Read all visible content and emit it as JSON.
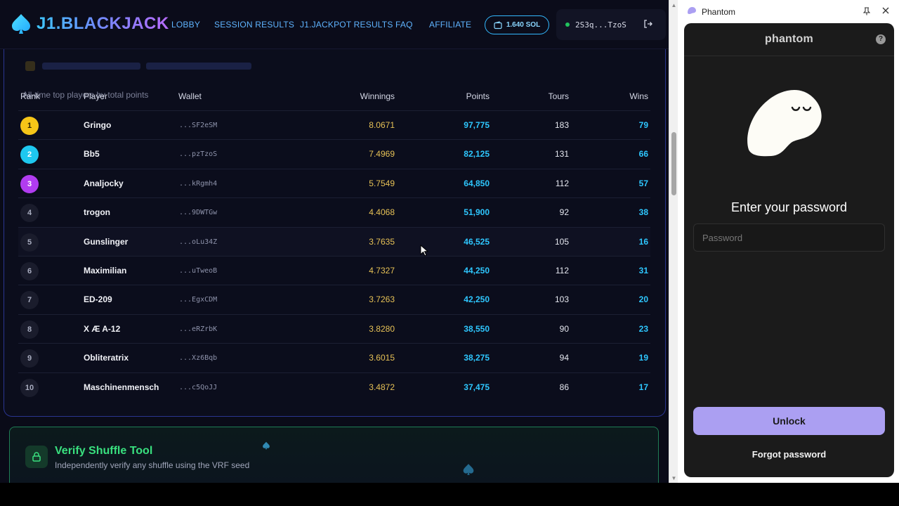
{
  "app": {
    "logo_text": "J1.BLACKJACK",
    "nav": [
      "LOBBY",
      "SESSION RESULTS",
      "J1.JACKPOT RESULTS",
      "FAQ",
      "AFFILIATE"
    ],
    "balance": "1.640 SOL",
    "wallet": "2S3q...TzoS",
    "colors": {
      "accent": "#2ec7ff",
      "gold": "#e6c156",
      "green": "#39e07f"
    }
  },
  "leaderboard": {
    "subtitle": "All-time top players by total points",
    "headers": {
      "rank": "Rank",
      "player": "Player",
      "wallet": "Wallet",
      "winnings": "Winnings",
      "points": "Points",
      "tours": "Tours",
      "wins": "Wins"
    },
    "rows": [
      {
        "rank": "1",
        "player": "Gringo",
        "wallet": "...SF2eSM",
        "winnings": "8.0671",
        "points": "97,775",
        "tours": "183",
        "wins": "79",
        "badge": "#f5c518",
        "badge_text": "#2a2000"
      },
      {
        "rank": "2",
        "player": "Bb5",
        "wallet": "...pzTzoS",
        "winnings": "7.4969",
        "points": "82,125",
        "tours": "131",
        "wins": "66",
        "badge": "#1ec8f0",
        "badge_text": "#ffffff"
      },
      {
        "rank": "3",
        "player": "Analjocky",
        "wallet": "...kRgmh4",
        "winnings": "5.7549",
        "points": "64,850",
        "tours": "112",
        "wins": "57",
        "badge": "#b13cf0",
        "badge_text": "#ffffff"
      },
      {
        "rank": "4",
        "player": "trogon",
        "wallet": "...9DWTGw",
        "winnings": "4.4068",
        "points": "51,900",
        "tours": "92",
        "wins": "38",
        "badge": "#1a1c2c",
        "badge_text": "#a8acbf"
      },
      {
        "rank": "5",
        "player": "Gunslinger",
        "wallet": "...oLu34Z",
        "winnings": "3.7635",
        "points": "46,525",
        "tours": "105",
        "wins": "16",
        "badge": "#1a1c2c",
        "badge_text": "#a8acbf"
      },
      {
        "rank": "6",
        "player": "Maximilian",
        "wallet": "...uTweoB",
        "winnings": "4.7327",
        "points": "44,250",
        "tours": "112",
        "wins": "31",
        "badge": "#1a1c2c",
        "badge_text": "#a8acbf"
      },
      {
        "rank": "7",
        "player": "ED-209",
        "wallet": "...EgxCDM",
        "winnings": "3.7263",
        "points": "42,250",
        "tours": "103",
        "wins": "20",
        "badge": "#1a1c2c",
        "badge_text": "#a8acbf"
      },
      {
        "rank": "8",
        "player": "X Æ A-12",
        "wallet": "...eRZrbK",
        "winnings": "3.8280",
        "points": "38,550",
        "tours": "90",
        "wins": "23",
        "badge": "#1a1c2c",
        "badge_text": "#a8acbf"
      },
      {
        "rank": "9",
        "player": "Obliteratrix",
        "wallet": "...Xz6Bqb",
        "winnings": "3.6015",
        "points": "38,275",
        "tours": "94",
        "wins": "19",
        "badge": "#1a1c2c",
        "badge_text": "#a8acbf"
      },
      {
        "rank": "10",
        "player": "Maschinenmensch",
        "wallet": "...c5QoJJ",
        "winnings": "3.4872",
        "points": "37,475",
        "tours": "86",
        "wins": "17",
        "badge": "#1a1c2c",
        "badge_text": "#a8acbf"
      }
    ]
  },
  "verify": {
    "title": "Verify Shuffle Tool",
    "subtitle": "Independently verify any shuffle using the VRF seed"
  },
  "phantom": {
    "window_title": "Phantom",
    "brand": "phantom",
    "heading": "Enter your password",
    "password_placeholder": "Password",
    "unlock_label": "Unlock",
    "forgot_label": "Forgot password",
    "accent": "#ab9ff2"
  }
}
